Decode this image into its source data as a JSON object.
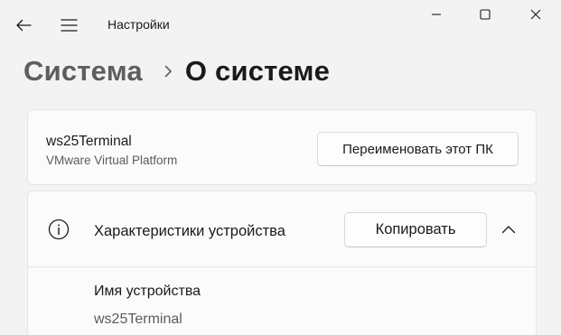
{
  "titlebar": {
    "app_title": "Настройки",
    "icons": [
      "back-arrow-icon",
      "hamburger-menu-icon",
      "minimize-icon",
      "maximize-icon",
      "close-icon"
    ]
  },
  "breadcrumb": {
    "parent": "Система",
    "separator_icon": "chevron-right-icon",
    "current": "О системе"
  },
  "device": {
    "name": "ws25Terminal",
    "model": "VMware Virtual Platform",
    "rename_label": "Переименовать этот ПК"
  },
  "specs": {
    "icon": "info-icon",
    "title": "Характеристики устройства",
    "copy_label": "Копировать",
    "collapse_icon": "chevron-up-icon",
    "items": [
      {
        "label": "Имя устройства",
        "value": "ws25Terminal"
      }
    ]
  }
}
